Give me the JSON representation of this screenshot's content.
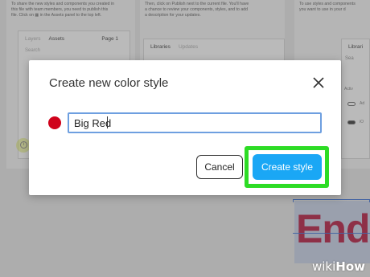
{
  "background": {
    "left_panel_text": "To share the new styles and components you created in\nthis file with team members, you need to publish this\nfile. Click on ▦ in the Assets panel to the top left.",
    "mid_panel_text": "Then, click on Publish next to the current file. You'll have\na chance to review your components, styles, and to add\na description for your updates.",
    "right_panel_text": "To use styles and components\nyou want to use in your d",
    "left_tabs": [
      "Layers",
      "Assets"
    ],
    "left_page": "Page 1",
    "left_search": "Search",
    "mid_tabs": [
      "Libraries",
      "Updates"
    ],
    "right_tab": "Librari",
    "right_search": "Sea",
    "right_label_active": "Activ",
    "right_label_ad": "Ad",
    "right_label_o": "iO",
    "big_text": "End"
  },
  "dialog": {
    "title": "Create new color style",
    "swatch_color": "#d0021b",
    "name_value": "Big Red",
    "cancel_label": "Cancel",
    "create_label": "Create style"
  },
  "colors": {
    "accent_blue": "#1aa7f5",
    "highlight_green": "#2ddc25",
    "input_border": "#6e9fe0"
  },
  "watermark": {
    "prefix": "wiki",
    "suffix": "How"
  }
}
